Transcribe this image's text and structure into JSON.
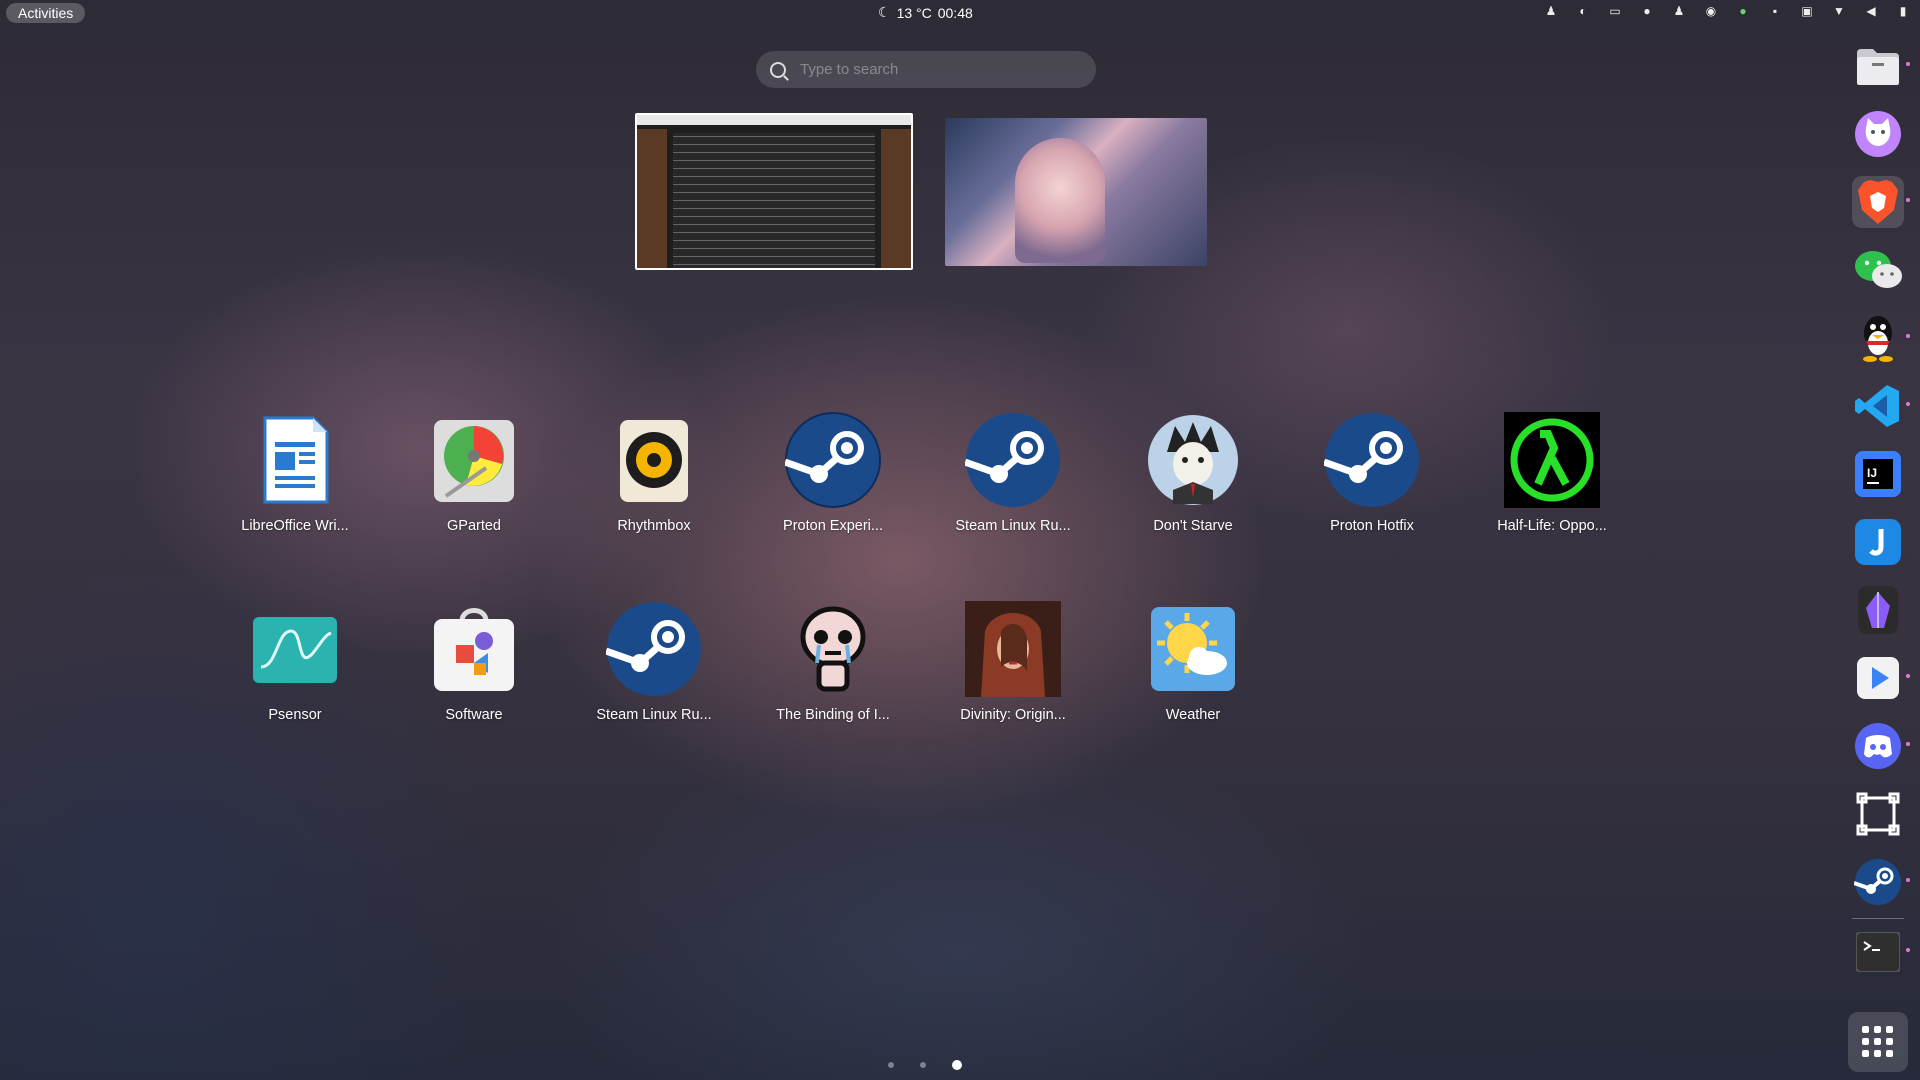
{
  "topbar": {
    "activities_label": "Activities",
    "weather_icon": "moon-icon",
    "temperature": "13 °C",
    "time": "00:48",
    "tray_icons": [
      "qq-tray-icon",
      "steam-tray-icon",
      "keyboard-icon",
      "wechat-tray-icon",
      "qq-tray-icon-2",
      "discord-tray-icon",
      "green-status-icon",
      "box-icon",
      "clipboard-icon",
      "wifi-icon",
      "volume-icon",
      "battery-icon"
    ]
  },
  "search": {
    "placeholder": "Type to search"
  },
  "windows": [
    "terminal-window-thumbnail",
    "anime-wallpaper-window-thumbnail"
  ],
  "apps_row1": [
    {
      "label": "LibreOffice Wri...",
      "icon": "libreoffice-writer-icon"
    },
    {
      "label": "GParted",
      "icon": "gparted-icon"
    },
    {
      "label": "Rhythmbox",
      "icon": "rhythmbox-icon"
    },
    {
      "label": "Proton Experi...",
      "icon": "steam-icon"
    },
    {
      "label": "Steam Linux Ru...",
      "icon": "steam-icon"
    },
    {
      "label": "Don't Starve",
      "icon": "dont-starve-icon"
    },
    {
      "label": "Proton Hotfix",
      "icon": "steam-icon"
    },
    {
      "label": "Half-Life: Oppo...",
      "icon": "half-life-icon"
    }
  ],
  "apps_row2": [
    {
      "label": "Psensor",
      "icon": "psensor-icon"
    },
    {
      "label": "Software",
      "icon": "software-icon"
    },
    {
      "label": "Steam Linux Ru...",
      "icon": "steam-icon"
    },
    {
      "label": "The Binding of I...",
      "icon": "binding-of-isaac-icon"
    },
    {
      "label": "Divinity: Origin...",
      "icon": "divinity-icon"
    },
    {
      "label": "Weather",
      "icon": "weather-icon"
    }
  ],
  "pagination": {
    "pages": 3,
    "current": 3
  },
  "dock": [
    "files",
    "cat-app",
    "brave",
    "wechat",
    "qq",
    "vscode",
    "intellij",
    "jetbrains-toolbox",
    "obsidian",
    "video-player",
    "discord",
    "screenshot-tool",
    "steam",
    "terminal",
    "app-grid"
  ],
  "colors": {
    "accent": "#e07ad8",
    "steam": "#1b4a8a"
  }
}
